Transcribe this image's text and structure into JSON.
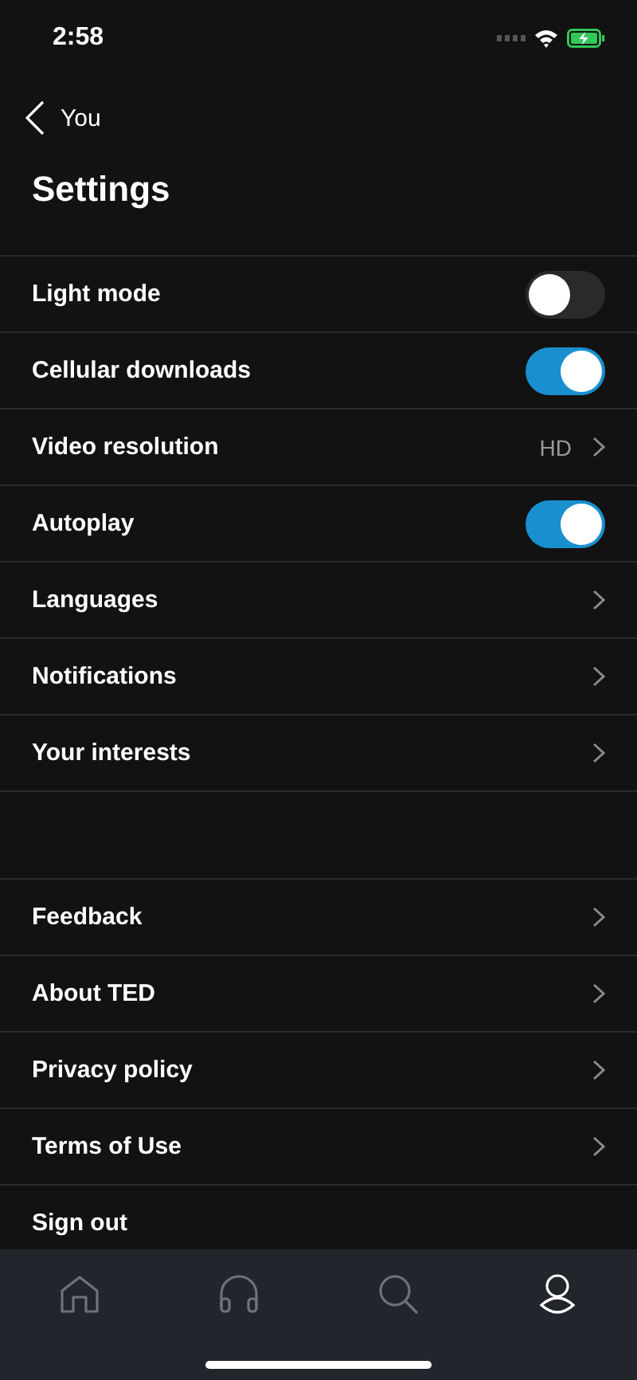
{
  "status_bar": {
    "time": "2:58"
  },
  "nav": {
    "back_label": "You",
    "title": "Settings"
  },
  "sections": [
    {
      "items": [
        {
          "kind": "toggle",
          "label": "Light mode",
          "on": false
        },
        {
          "kind": "toggle",
          "label": "Cellular downloads",
          "on": true
        },
        {
          "kind": "value",
          "label": "Video resolution",
          "value": "HD"
        },
        {
          "kind": "toggle",
          "label": "Autoplay",
          "on": true
        },
        {
          "kind": "link",
          "label": "Languages"
        },
        {
          "kind": "link",
          "label": "Notifications"
        },
        {
          "kind": "link",
          "label": "Your interests"
        }
      ]
    },
    {
      "items": [
        {
          "kind": "link",
          "label": "Feedback"
        },
        {
          "kind": "link",
          "label": "About TED"
        },
        {
          "kind": "link",
          "label": "Privacy policy"
        },
        {
          "kind": "link",
          "label": "Terms of Use"
        },
        {
          "kind": "plain",
          "label": "Sign out"
        }
      ]
    }
  ],
  "tab_bar": [
    {
      "kind": "home",
      "selected": false
    },
    {
      "kind": "audio",
      "selected": false
    },
    {
      "kind": "search",
      "selected": false
    },
    {
      "kind": "profile",
      "selected": true
    }
  ]
}
